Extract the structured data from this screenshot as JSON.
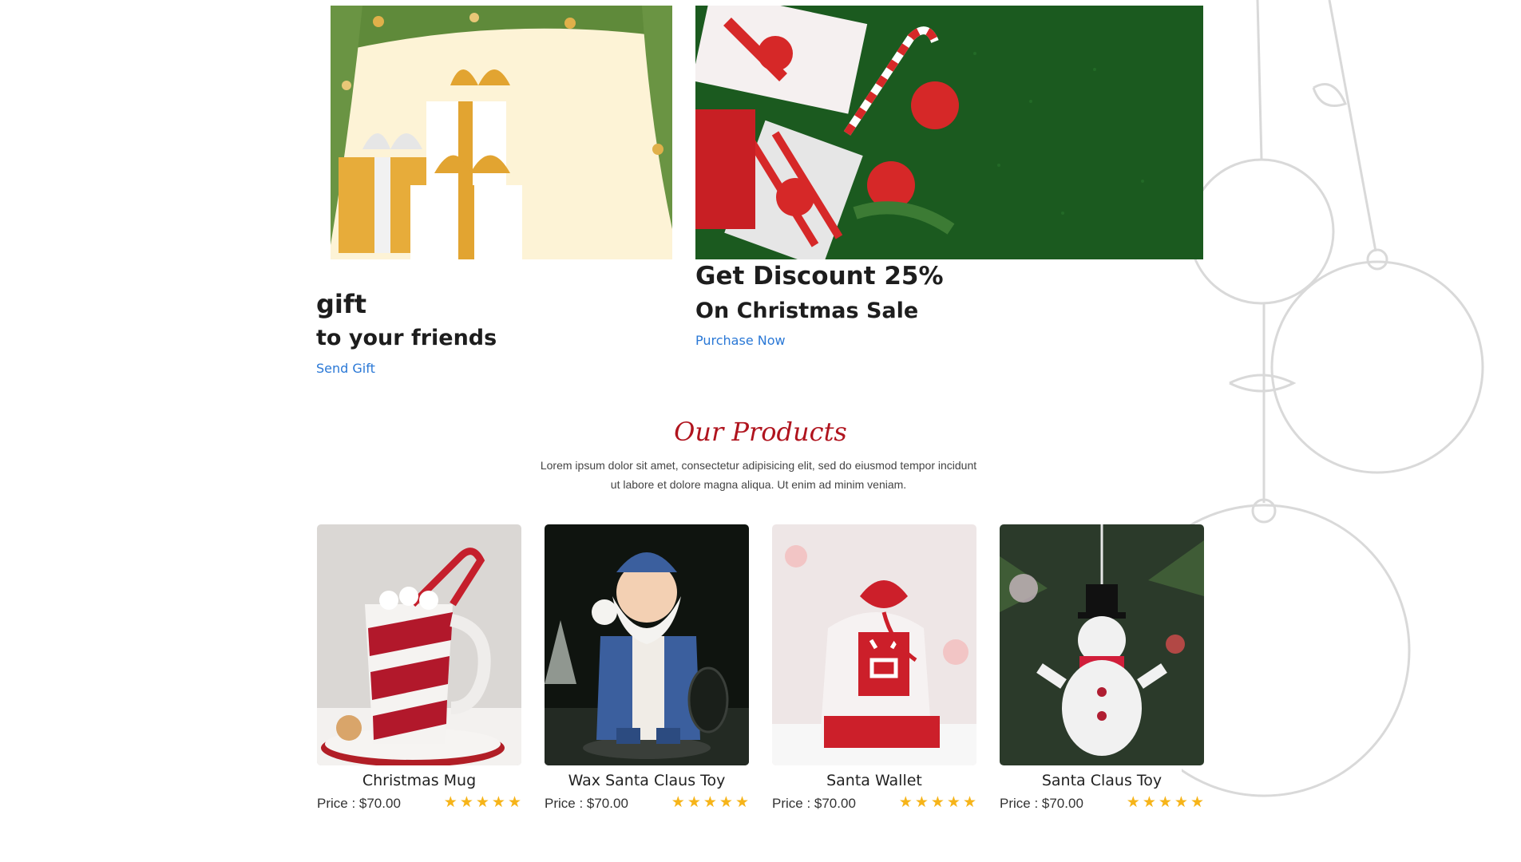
{
  "promos": {
    "gift": {
      "title": "gift",
      "subtitle": "to your friends",
      "link": "Send Gift"
    },
    "discount": {
      "title": "Get Discount 25%",
      "subtitle": "On Christmas Sale",
      "link": "Purchase Now"
    }
  },
  "products_section": {
    "title": "Our Products",
    "description": "Lorem ipsum dolor sit amet, consectetur adipisicing elit, sed do eiusmod tempor incidunt ut labore et dolore magna aliqua. Ut enim ad minim veniam."
  },
  "products": [
    {
      "name": "Christmas Mug",
      "price": "Price : $70.00",
      "rating": 5
    },
    {
      "name": "Wax Santa Claus Toy",
      "price": "Price : $70.00",
      "rating": 5
    },
    {
      "name": "Santa Wallet",
      "price": "Price : $70.00",
      "rating": 5
    },
    {
      "name": "Santa Claus Toy",
      "price": "Price : $70.00",
      "rating": 5
    }
  ],
  "colors": {
    "accent_red": "#b0141e",
    "link_blue": "#2a78d6",
    "star": "#f6b419",
    "banner_green": "#1b5a1f"
  }
}
